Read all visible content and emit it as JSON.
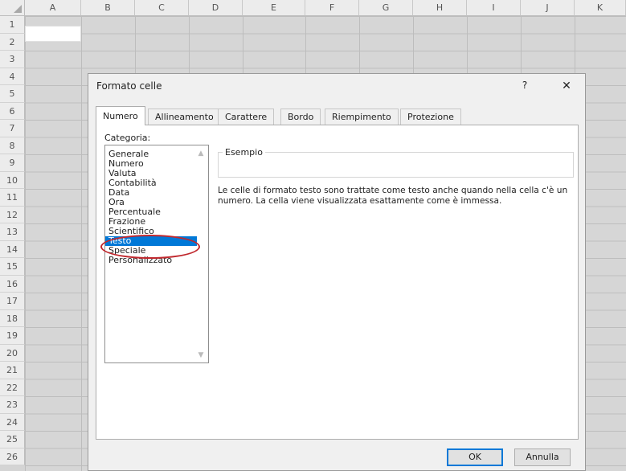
{
  "sheet": {
    "columns": [
      "A",
      "B",
      "C",
      "D",
      "E",
      "F",
      "G",
      "H",
      "I",
      "J",
      "K"
    ],
    "rows": [
      "1",
      "2",
      "3",
      "4",
      "5",
      "6",
      "7",
      "8",
      "9",
      "10",
      "11",
      "12",
      "13",
      "14",
      "15",
      "16",
      "17",
      "18",
      "19",
      "20",
      "21",
      "22",
      "23",
      "24",
      "25",
      "26"
    ]
  },
  "dialog": {
    "title": "Formato celle",
    "help": "?",
    "close": "✕",
    "tabs": [
      "Numero",
      "Allineamento",
      "Carattere",
      "Bordo",
      "Riempimento",
      "Protezione"
    ],
    "active_tab": "Numero",
    "category_label": "Categoria:",
    "categories": [
      "Generale",
      "Numero",
      "Valuta",
      "Contabilità",
      "Data",
      "Ora",
      "Percentuale",
      "Frazione",
      "Scientifico",
      "Testo",
      "Speciale",
      "Personalizzato"
    ],
    "selected_category": "Testo",
    "example_label": "Esempio",
    "description": "Le celle di formato testo sono trattate come testo anche quando nella cella c'è un numero. La cella viene visualizzata esattamente come è immessa.",
    "ok_label": "OK",
    "cancel_label": "Annulla"
  },
  "colors": {
    "selection": "#0078d7",
    "highlight_oval": "#c0282e"
  }
}
